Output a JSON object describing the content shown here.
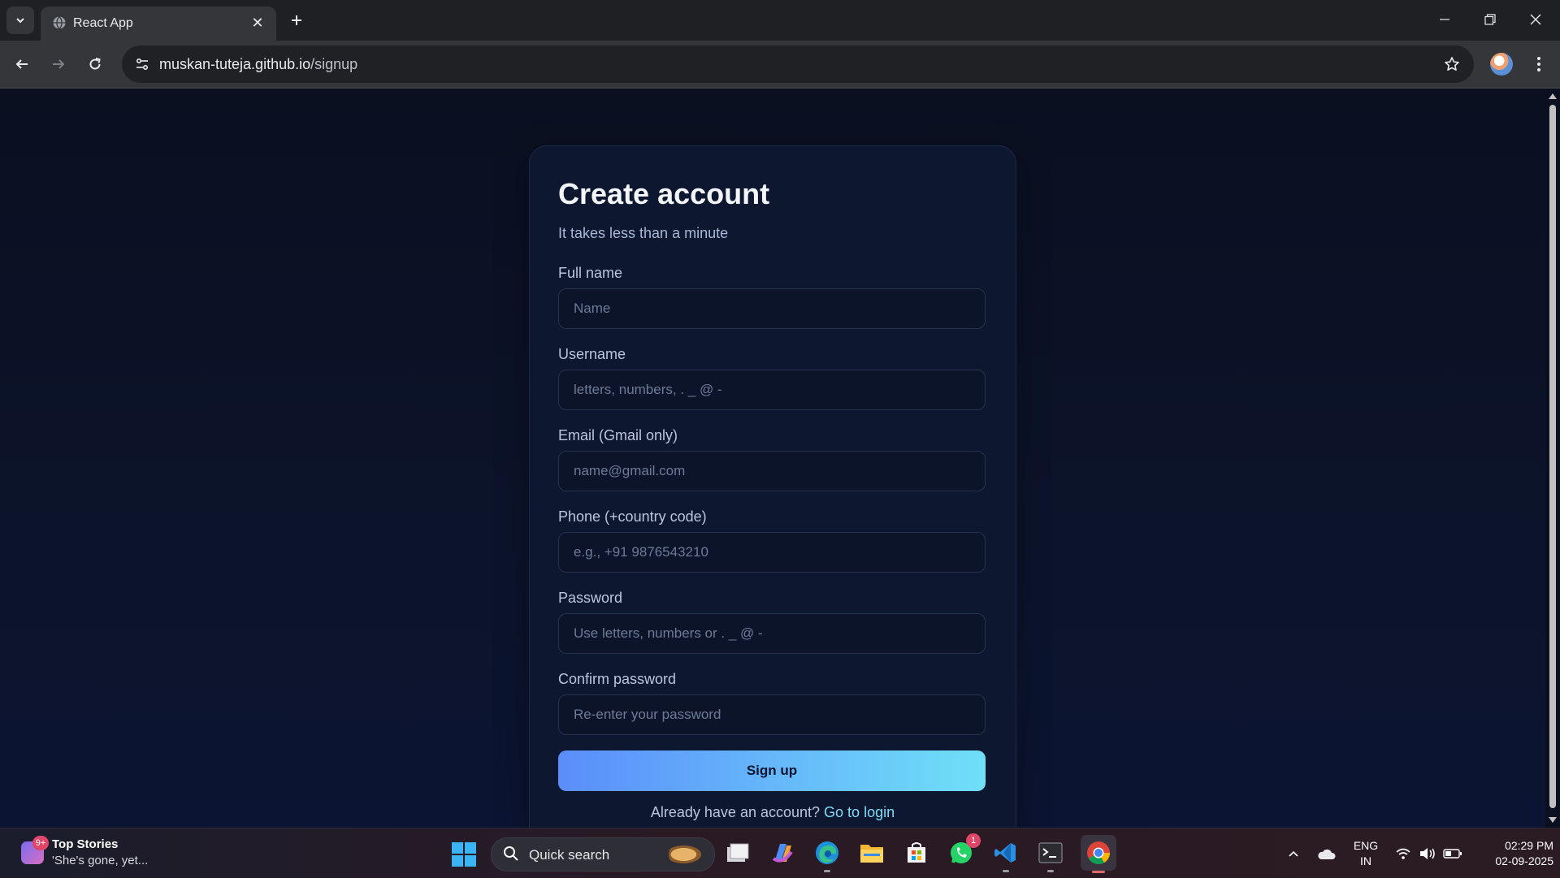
{
  "browser": {
    "tab_title": "React App",
    "url_host": "muskan-tuteja.github.io",
    "url_path": "/signup"
  },
  "signup": {
    "title": "Create account",
    "subtitle": "It takes less than a minute",
    "fields": [
      {
        "label": "Full name",
        "placeholder": "Name"
      },
      {
        "label": "Username",
        "placeholder": "letters, numbers, . _ @ -"
      },
      {
        "label": "Email (Gmail only)",
        "placeholder": "name@gmail.com"
      },
      {
        "label": "Phone (+country code)",
        "placeholder": "e.g., +91 9876543210"
      },
      {
        "label": "Password",
        "placeholder": "Use letters, numbers or . _ @ -"
      },
      {
        "label": "Confirm password",
        "placeholder": "Re-enter your password"
      }
    ],
    "submit_label": "Sign up",
    "login_prompt": "Already have an account?",
    "login_link": "Go to login"
  },
  "taskbar": {
    "news_badge": "9+",
    "news_title": "Top Stories",
    "news_headline": "'She's gone, yet...",
    "search_label": "Quick search",
    "whatsapp_badge": "1",
    "lang_line1": "ENG",
    "lang_line2": "IN",
    "time": "02:29 PM",
    "date": "02-09-2025"
  },
  "colors": {
    "page_bg": "#0a1022",
    "card_bg": "#0e1730",
    "button_gradient_start": "#5b8dfb",
    "button_gradient_end": "#6fe0f8",
    "link": "#7fdcf8"
  }
}
